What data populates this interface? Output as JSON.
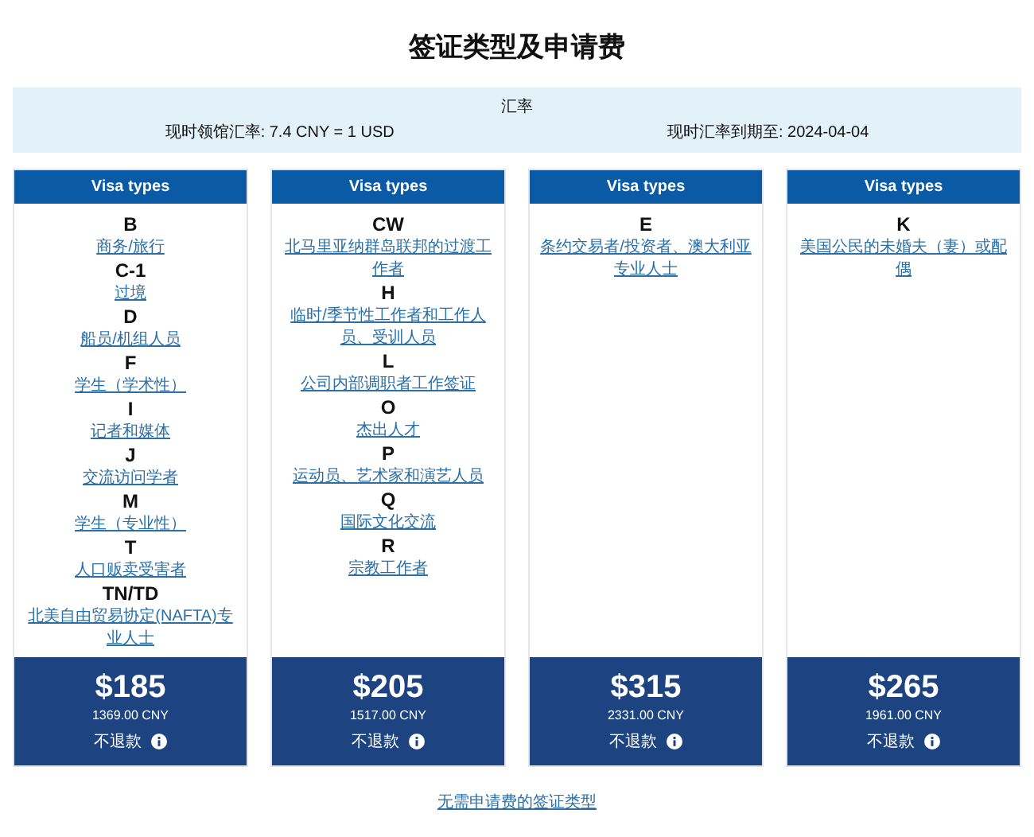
{
  "title": "签证类型及申请费",
  "exchange": {
    "heading": "汇率",
    "rate": "现时领馆汇率: 7.4 CNY = 1 USD",
    "expiry": "现时汇率到期至: 2024-04-04"
  },
  "cards": [
    {
      "header": "Visa types",
      "types": [
        {
          "code": "B",
          "name": "商务/旅行"
        },
        {
          "code": "C-1",
          "name": "过境"
        },
        {
          "code": "D",
          "name": "船员/机组人员"
        },
        {
          "code": "F",
          "name": "学生（学术性）"
        },
        {
          "code": "I",
          "name": "记者和媒体"
        },
        {
          "code": "J",
          "name": "交流访问学者"
        },
        {
          "code": "M",
          "name": "学生（专业性）"
        },
        {
          "code": "T",
          "name": "人口贩卖受害者"
        },
        {
          "code": "TN/TD",
          "name": "北美自由贸易协定(NAFTA)专业人士"
        }
      ],
      "price": "$185",
      "cny": "1369.00 CNY",
      "refund": "不退款"
    },
    {
      "header": "Visa types",
      "types": [
        {
          "code": "CW",
          "name": "北马里亚纳群岛联邦的过渡工作者"
        },
        {
          "code": "H",
          "name": "临时/季节性工作者和工作人员、受训人员"
        },
        {
          "code": "L",
          "name": "公司内部调职者工作签证"
        },
        {
          "code": "O",
          "name": "杰出人才"
        },
        {
          "code": "P",
          "name": "运动员、艺术家和演艺人员"
        },
        {
          "code": "Q",
          "name": "国际文化交流"
        },
        {
          "code": "R",
          "name": "宗教工作者"
        }
      ],
      "price": "$205",
      "cny": "1517.00 CNY",
      "refund": "不退款"
    },
    {
      "header": "Visa types",
      "types": [
        {
          "code": "E",
          "name": "条约交易者/投资者、澳大利亚专业人士"
        }
      ],
      "price": "$315",
      "cny": "2331.00 CNY",
      "refund": "不退款"
    },
    {
      "header": "Visa types",
      "types": [
        {
          "code": "K",
          "name": "美国公民的未婚夫（妻）或配偶"
        }
      ],
      "price": "$265",
      "cny": "1961.00 CNY",
      "refund": "不退款"
    }
  ],
  "footer_link": "无需申请费的签证类型"
}
